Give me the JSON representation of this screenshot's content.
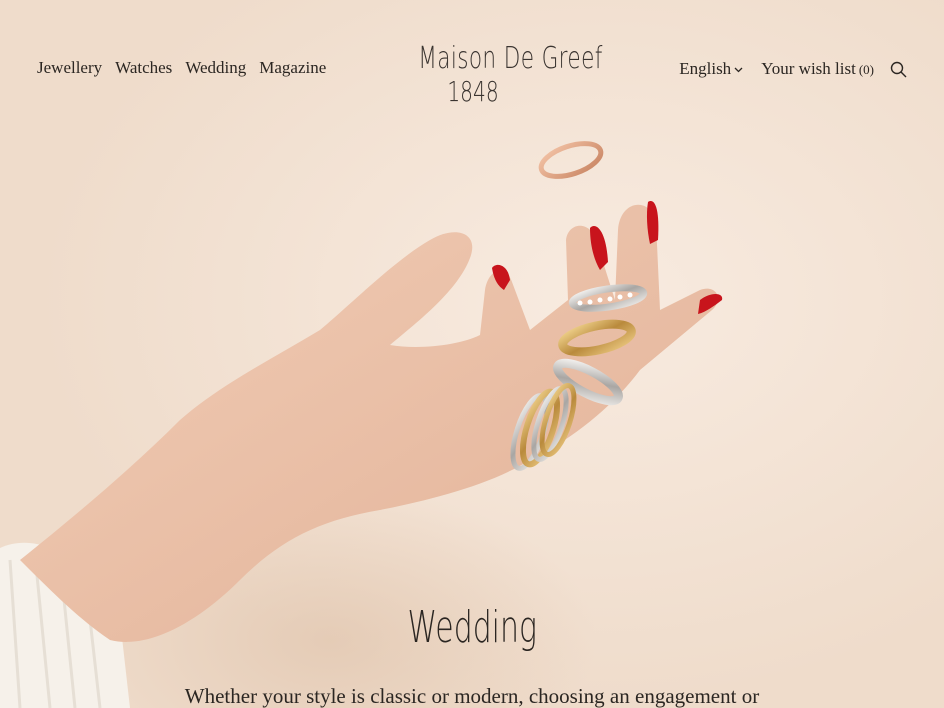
{
  "nav": {
    "left": [
      {
        "label": "Jewellery"
      },
      {
        "label": "Watches"
      },
      {
        "label": "Wedding"
      },
      {
        "label": "Magazine"
      }
    ],
    "language": "English",
    "wishlist_label": "Your wish list",
    "wishlist_count": "(0)"
  },
  "logo": {
    "name": "Maison De Greef",
    "year": "1848"
  },
  "hero": {
    "title": "Wedding",
    "intro": "Whether your style is classic or modern, choosing an engagement or"
  },
  "colors": {
    "background": "#f2e3d6",
    "text": "#2b2622",
    "nail": "#c8141c",
    "gold": "#c9a25a",
    "rose_gold": "#d59a7c",
    "silver": "#d6d4d2"
  },
  "icons": {
    "language_chevron": "chevron-down-icon",
    "search": "search-icon"
  }
}
